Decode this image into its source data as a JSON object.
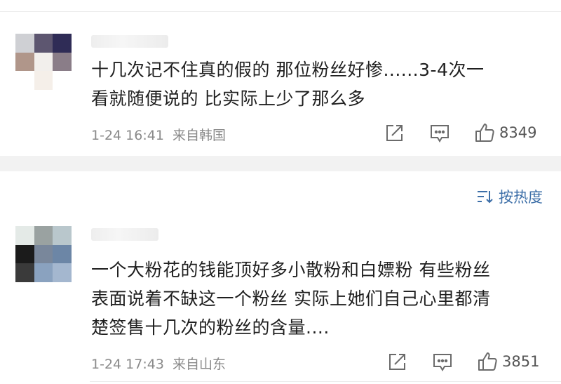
{
  "comments": [
    {
      "text_lines": [
        "十几次记不住真的假的 那位粉丝好惨......3-4次一",
        "看就随便说的 比实际上少了那么多"
      ],
      "time": "1-24 16:41",
      "source": "来自韩国",
      "likes": "8349",
      "avatar_colors": [
        "#cfd0d4",
        "#5d5670",
        "#2f2c56",
        "#b0968a",
        "#f2efec",
        "#8a7d88",
        "#ffffff",
        "#f5efe9",
        "#ffffff"
      ]
    },
    {
      "text_lines": [
        "一个大粉花的钱能顶好多小散粉和白嫖粉 有些粉丝",
        "表面说着不缺这一个粉丝 实际上她们自己心里都清",
        "楚签售十几次的粉丝的含量...."
      ],
      "time": "1-24 17:43",
      "source": "来自山东",
      "likes": "3851",
      "avatar_colors": [
        "#e4eae7",
        "#9aa2a1",
        "#b9c7cc",
        "#1b1b1b",
        "#79879b",
        "#6c86a6",
        "#3a3a3a",
        "#8aa2bf",
        "#a4b7cf"
      ]
    }
  ],
  "sort": {
    "label": "按热度"
  },
  "colors": {
    "accent": "#3d6fa8",
    "meta": "#8a8a8a",
    "separator": "#f2f2f2"
  },
  "icons": {
    "share": "share-icon",
    "comment": "comment-icon",
    "like": "thumbs-up-icon",
    "sort": "sort-icon"
  }
}
